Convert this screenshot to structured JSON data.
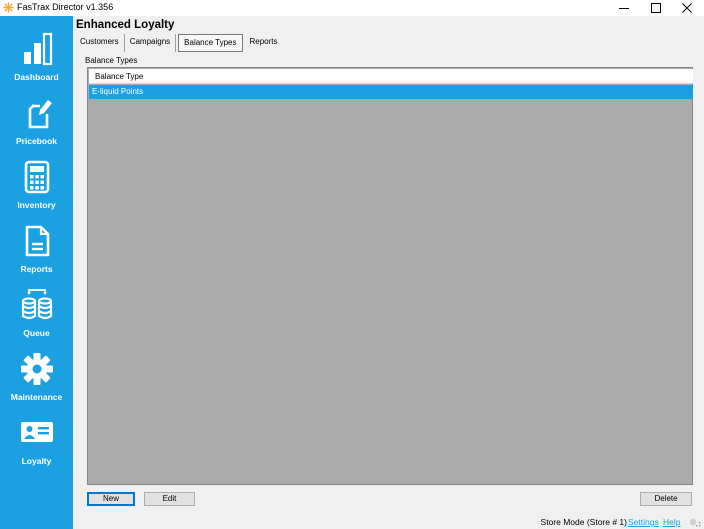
{
  "window": {
    "title": "FasTrax Director v1.356",
    "controls": {
      "minimize": "minimize",
      "maximize": "maximize",
      "close": "close"
    }
  },
  "sidebar": {
    "items": [
      {
        "label": "Dashboard",
        "icon": "bar-chart-icon"
      },
      {
        "label": "Pricebook",
        "icon": "tag-edit-icon"
      },
      {
        "label": "Inventory",
        "icon": "calculator-icon"
      },
      {
        "label": "Reports",
        "icon": "document-icon"
      },
      {
        "label": "Queue",
        "icon": "database-sync-icon"
      },
      {
        "label": "Maintenance",
        "icon": "gear-icon"
      },
      {
        "label": "Loyalty",
        "icon": "id-card-icon"
      }
    ],
    "background_color": "#1ba1e2"
  },
  "main": {
    "title": "Enhanced Loyalty",
    "tabs": [
      {
        "label": "Customers",
        "active": false
      },
      {
        "label": "Campaigns",
        "active": false
      },
      {
        "label": "Balance Types",
        "active": true
      },
      {
        "label": "Reports",
        "active": false
      }
    ],
    "group_label": "Balance Types",
    "grid": {
      "columns": [
        "Balance Type"
      ],
      "rows": [
        {
          "balance_type": "E-liquid Points",
          "selected": true
        }
      ],
      "selection_color": "#1ba1e2"
    },
    "buttons": {
      "new": "New",
      "edit": "Edit",
      "delete": "Delete"
    }
  },
  "status": {
    "mode": "Store Mode (Store # 1)",
    "settings_link": "Settings",
    "help_link": "Help"
  }
}
